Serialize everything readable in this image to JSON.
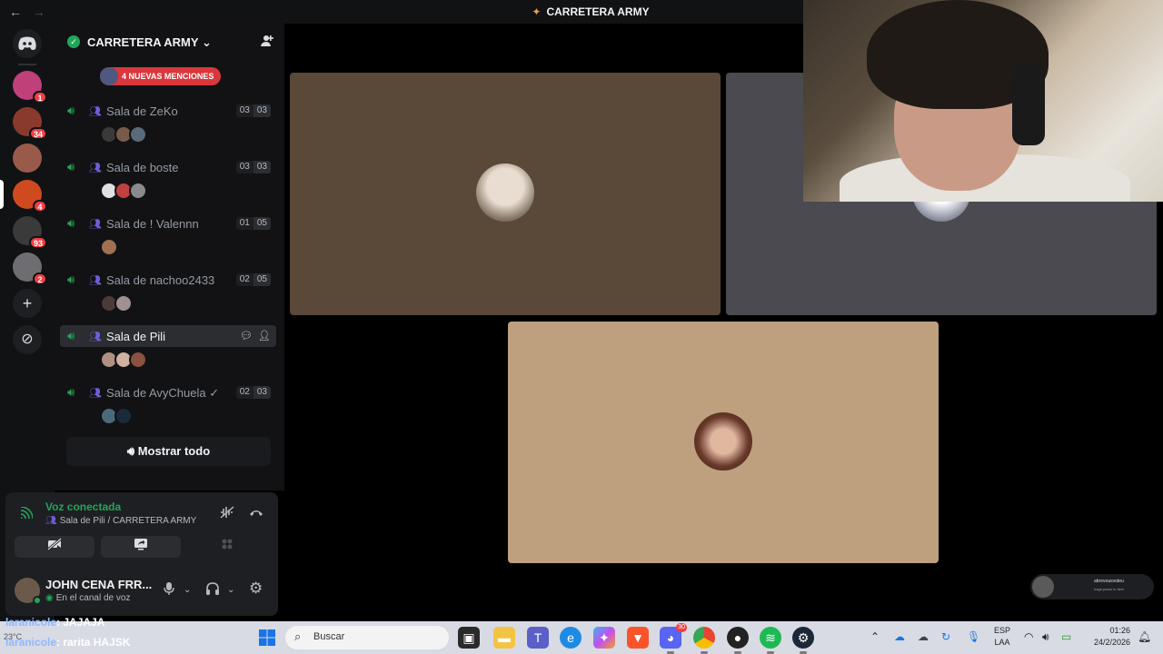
{
  "window": {
    "title": "CARRETERA ARMY",
    "back": "←",
    "forward": "→"
  },
  "rail": {
    "servers": [
      {
        "name": "server-1",
        "badge": "1",
        "color": "#c0407a"
      },
      {
        "name": "server-2",
        "badge": "34",
        "color": "#8a3a2c"
      },
      {
        "name": "server-3",
        "badge": "",
        "color": "#9a5a4a"
      },
      {
        "name": "server-4",
        "badge": "4",
        "color": "#d04a20"
      },
      {
        "name": "server-5",
        "badge": "93",
        "color": "#3a3a3a"
      },
      {
        "name": "server-6",
        "badge": "2",
        "color": "#6e6e72"
      }
    ],
    "add_icon": "+",
    "discover_icon": "⊘"
  },
  "server": {
    "name": "CARRETERA ARMY",
    "chevron": "⌄",
    "mentions": "4 NUEVAS MENCIONES",
    "show_all": "Mostrar todo"
  },
  "channels": [
    {
      "name": "Sala de ZeKo",
      "count_a": "03",
      "count_b": "03",
      "avatars": [
        "#3a3a3a",
        "#7a5a4a",
        "#5a6a7a"
      ],
      "selected": false
    },
    {
      "name": "Sala de boste",
      "count_a": "03",
      "count_b": "03",
      "avatars": [
        "#e0e0e0",
        "#c04040",
        "#8a8a8a"
      ],
      "selected": false
    },
    {
      "name": "Sala de ! Valennn",
      "count_a": "01",
      "count_b": "05",
      "avatars": [
        "#a07050"
      ],
      "selected": false
    },
    {
      "name": "Sala de nachoo2433",
      "count_a": "02",
      "count_b": "05",
      "avatars": [
        "#4a3a3a",
        "#a09090"
      ],
      "selected": false
    },
    {
      "name": "Sala de Pili",
      "count_a": "",
      "count_b": "",
      "avatars": [
        "#b09080",
        "#d0b0a0",
        "#8a5040"
      ],
      "selected": true
    },
    {
      "name": "Sala de AvyChuela ✓",
      "count_a": "02",
      "count_b": "03",
      "avatars": [
        "#4a6a7a",
        "#1a2a3a"
      ],
      "selected": false
    }
  ],
  "voice": {
    "status": "Voz conectada",
    "location": "Sala de Pili / CARRETERA ARMY",
    "user_name": "JOHN CENA FRR...",
    "user_status": "En el canal de voz"
  },
  "stage": {
    "tiles": [
      {
        "name": "tile-user-1",
        "bg": "#5a4838",
        "face": "#d8ccc0"
      },
      {
        "name": "tile-user-2",
        "bg": "#4a4a50",
        "face": "#c8c8d0"
      },
      {
        "name": "tile-user-3",
        "bg": "#bfa07e",
        "face": "#7a4a3a"
      }
    ]
  },
  "chat": [
    {
      "user": "laranicole",
      "text": ": JAJAJA"
    },
    {
      "user": "laranicole",
      "text": ": rarita HAJSK"
    }
  ],
  "mini_widget": {
    "line1": "abrevoasvoteu",
    "line2": "haga pasar tu desi"
  },
  "taskbar": {
    "search_placeholder": "Buscar",
    "weather": "23°C",
    "lang_1": "ESP",
    "lang_2": "LAA",
    "time": "01:26",
    "date": "24/2/2026",
    "discord_badge": "30"
  }
}
